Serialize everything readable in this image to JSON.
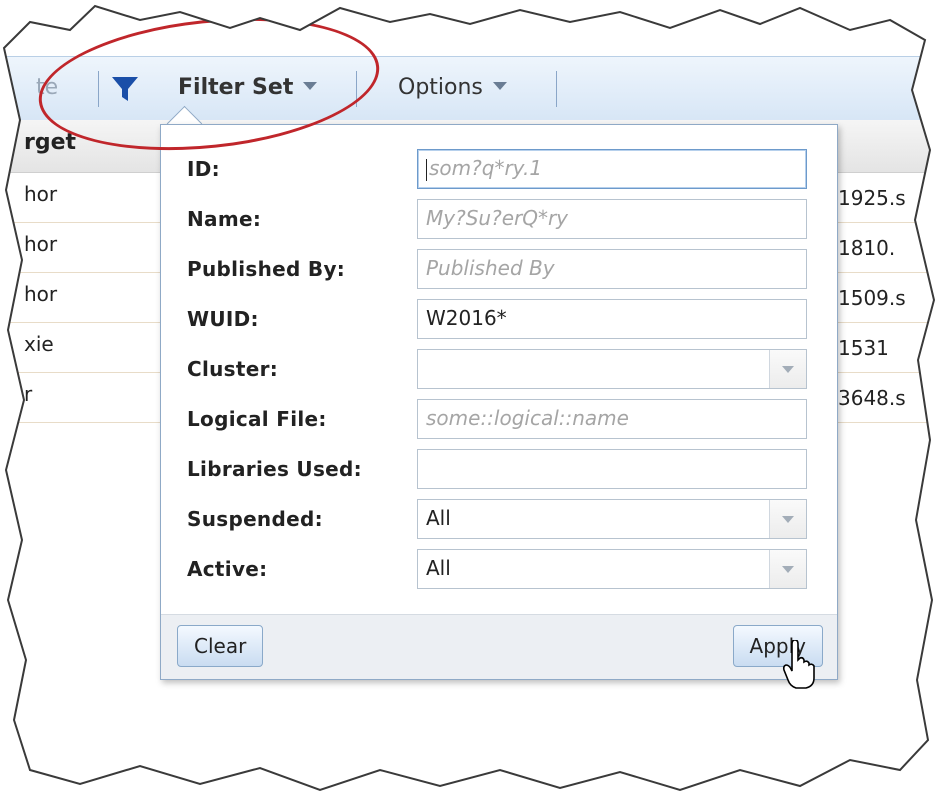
{
  "toolbar": {
    "partial_item": "te",
    "filter_set_label": "Filter Set",
    "options_label": "Options"
  },
  "grid": {
    "header": "rget",
    "rows": [
      {
        "c1": "hor",
        "c2": "1925.s"
      },
      {
        "c1": "hor",
        "c2": "1810."
      },
      {
        "c1": "hor",
        "c2": "1509.s"
      },
      {
        "c1": "xie",
        "c2": "1531"
      },
      {
        "c1": "r",
        "c2": "3648.s"
      }
    ]
  },
  "filter": {
    "fields": [
      {
        "label": "ID:",
        "value": "",
        "placeholder": "som?q*ry.1",
        "type": "text"
      },
      {
        "label": "Name:",
        "value": "",
        "placeholder": "My?Su?erQ*ry",
        "type": "text"
      },
      {
        "label": "Published  By:",
        "value": "",
        "placeholder": "Published By",
        "type": "text"
      },
      {
        "label": "WUID:",
        "value": "W2016*",
        "placeholder": "",
        "type": "text"
      },
      {
        "label": "Cluster:",
        "value": "",
        "placeholder": "",
        "type": "select"
      },
      {
        "label": "Logical  File:",
        "value": "",
        "placeholder": "some::logical::name",
        "type": "text"
      },
      {
        "label": "Libraries  Used:",
        "value": "",
        "placeholder": "",
        "type": "text"
      },
      {
        "label": "Suspended:",
        "value": "All",
        "placeholder": "",
        "type": "select"
      },
      {
        "label": "Active:",
        "value": "All",
        "placeholder": "",
        "type": "select"
      }
    ],
    "clear_label": "Clear",
    "apply_label": "Apply"
  },
  "colors": {
    "annotation": "#c0262b",
    "toolbar_bg": "#d7e6f6",
    "filter_icon": "#1a4fa8"
  }
}
